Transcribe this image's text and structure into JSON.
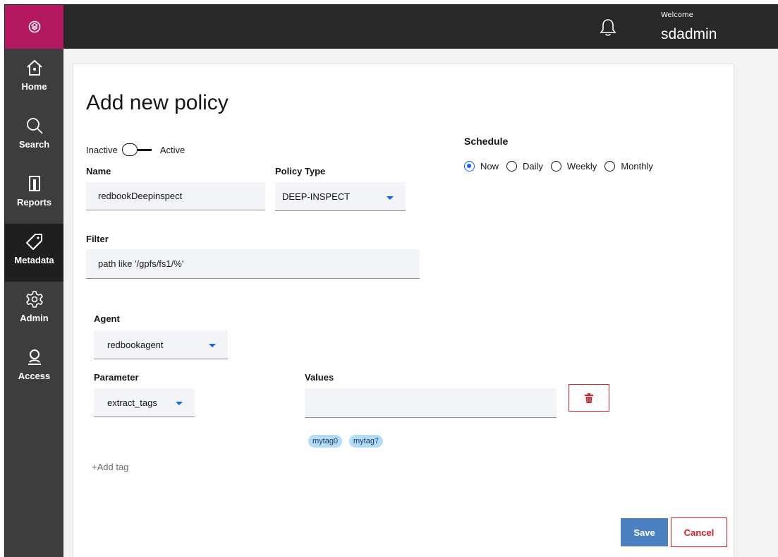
{
  "header": {
    "logo_icon": "cube-logo-icon",
    "bell_icon": "bell-icon",
    "welcome": "Welcome",
    "username": "sdadmin"
  },
  "sidebar": {
    "items": [
      {
        "label": "Home",
        "icon": "home-icon",
        "active": false
      },
      {
        "label": "Search",
        "icon": "search-icon",
        "active": false
      },
      {
        "label": "Reports",
        "icon": "reports-icon",
        "active": false
      },
      {
        "label": "Metadata",
        "icon": "tag-icon",
        "active": true
      },
      {
        "label": "Admin",
        "icon": "gear-icon",
        "active": false
      },
      {
        "label": "Access",
        "icon": "user-icon",
        "active": false
      }
    ]
  },
  "form": {
    "title": "Add new policy",
    "toggle": {
      "off_label": "Inactive",
      "on_label": "Active",
      "state": "inactive"
    },
    "name": {
      "label": "Name",
      "value": "redbookDeepinspect"
    },
    "policy_type": {
      "label": "Policy Type",
      "value": "DEEP-INSPECT"
    },
    "filter": {
      "label": "Filter",
      "value": "path like '/gpfs/fs1/%'"
    },
    "schedule": {
      "label": "Schedule",
      "options": [
        "Now",
        "Daily",
        "Weekly",
        "Monthly"
      ],
      "selected": "Now"
    },
    "agent": {
      "label": "Agent",
      "value": "redbookagent"
    },
    "parameter": {
      "label": "Parameter",
      "value": "extract_tags"
    },
    "values": {
      "label": "Values",
      "value": ""
    },
    "tags": [
      "mytag0",
      "mytag7"
    ],
    "add_tag": "+Add tag",
    "delete_icon": "trash-icon"
  },
  "actions": {
    "save": "Save",
    "cancel": "Cancel"
  },
  "colors": {
    "logo_bg": "#b4185f",
    "topbar": "#282828",
    "sidebar": "#3d3d3d",
    "primary": "#4d7fc3",
    "danger": "#da1e28",
    "radio_accent": "#0f62fe"
  }
}
